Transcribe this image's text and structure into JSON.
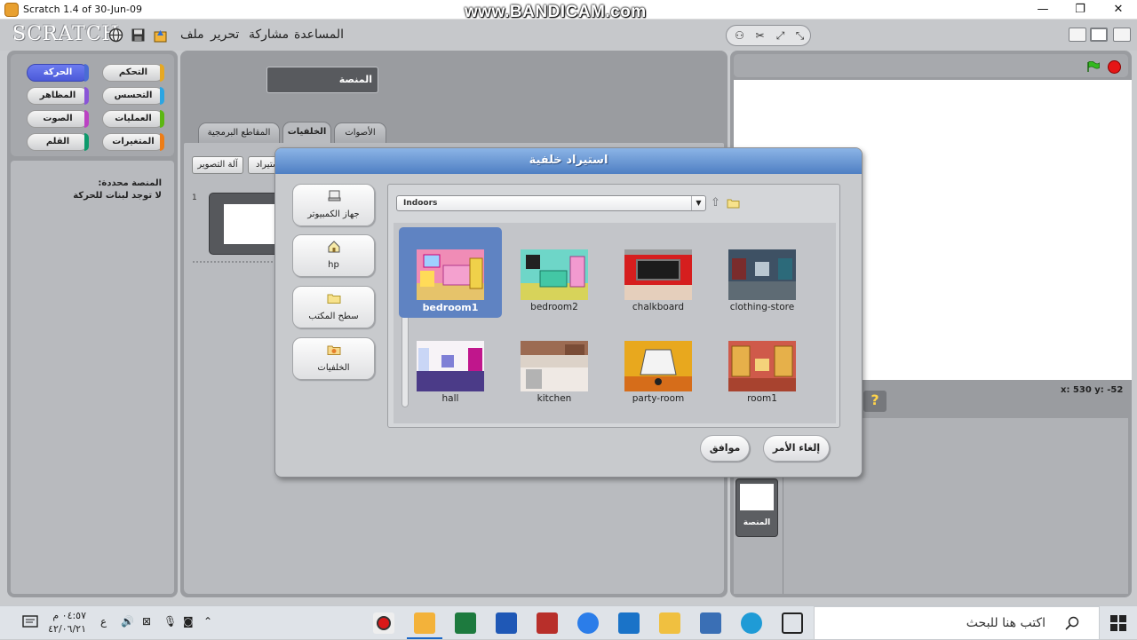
{
  "window": {
    "title": "Scratch 1.4 of 30-Jun-09",
    "watermark": "www.BANDICAM.com",
    "minimize": "—",
    "maximize": "❐",
    "close": "✕"
  },
  "menubar": {
    "logo": "SCRATCH",
    "menus": [
      "ملف",
      "تحرير",
      "مشاركة",
      "المساعدة"
    ],
    "tools": [
      "duplicate",
      "delete",
      "grow",
      "shrink"
    ]
  },
  "categories": [
    {
      "label": "الحركة",
      "color": "#4a6cd4",
      "active": true
    },
    {
      "label": "التحكم",
      "color": "#e6a822"
    },
    {
      "label": "المظاهر",
      "color": "#8a55d7"
    },
    {
      "label": "التحسس",
      "color": "#2ca5e2"
    },
    {
      "label": "الصوت",
      "color": "#bb42c3"
    },
    {
      "label": "العمليات",
      "color": "#5cb712"
    },
    {
      "label": "القلم",
      "color": "#0e9a6c"
    },
    {
      "label": "المتغيرات",
      "color": "#ee7d16"
    }
  ],
  "palette": {
    "line1": "المنصة محددة:",
    "line2": "لا توجد لبنات للحركة"
  },
  "sprite": {
    "name": "المنصة"
  },
  "tabs": [
    {
      "label": "المقاطع البرمجية"
    },
    {
      "label": "الخلفيات",
      "active": true
    },
    {
      "label": "الأصوات"
    }
  ],
  "costume_editor": {
    "camera_btn": "آلة التصوير",
    "import_btn": "استيراد",
    "number": "1"
  },
  "stage": {
    "coords": "x: 530  y: -52"
  },
  "stage_thumb": {
    "label": "المنصة"
  },
  "dialog": {
    "title": "استيراد خلفية",
    "locations": [
      {
        "label": "جهاز الكمبيوتر",
        "icon": "computer-icon"
      },
      {
        "label": "hp",
        "icon": "home-icon"
      },
      {
        "label": "سطح المكتب",
        "icon": "folder-icon"
      },
      {
        "label": "الخلفيات",
        "icon": "backgrounds-folder-icon"
      }
    ],
    "folder": "Indoors",
    "files": [
      {
        "name": "bedroom1",
        "selected": true
      },
      {
        "name": "bedroom2"
      },
      {
        "name": "chalkboard"
      },
      {
        "name": "clothing-store"
      },
      {
        "name": "hall"
      },
      {
        "name": "kitchen"
      },
      {
        "name": "party-room"
      },
      {
        "name": "room1"
      }
    ],
    "ok": "موافق",
    "cancel": "إلغاء الأمر"
  },
  "taskbar": {
    "search_placeholder": "اكتب هنا للبحث",
    "time": "٠٤:٥٧ م",
    "date": "٤٢/٠٦/٢١",
    "lang": "ع"
  }
}
